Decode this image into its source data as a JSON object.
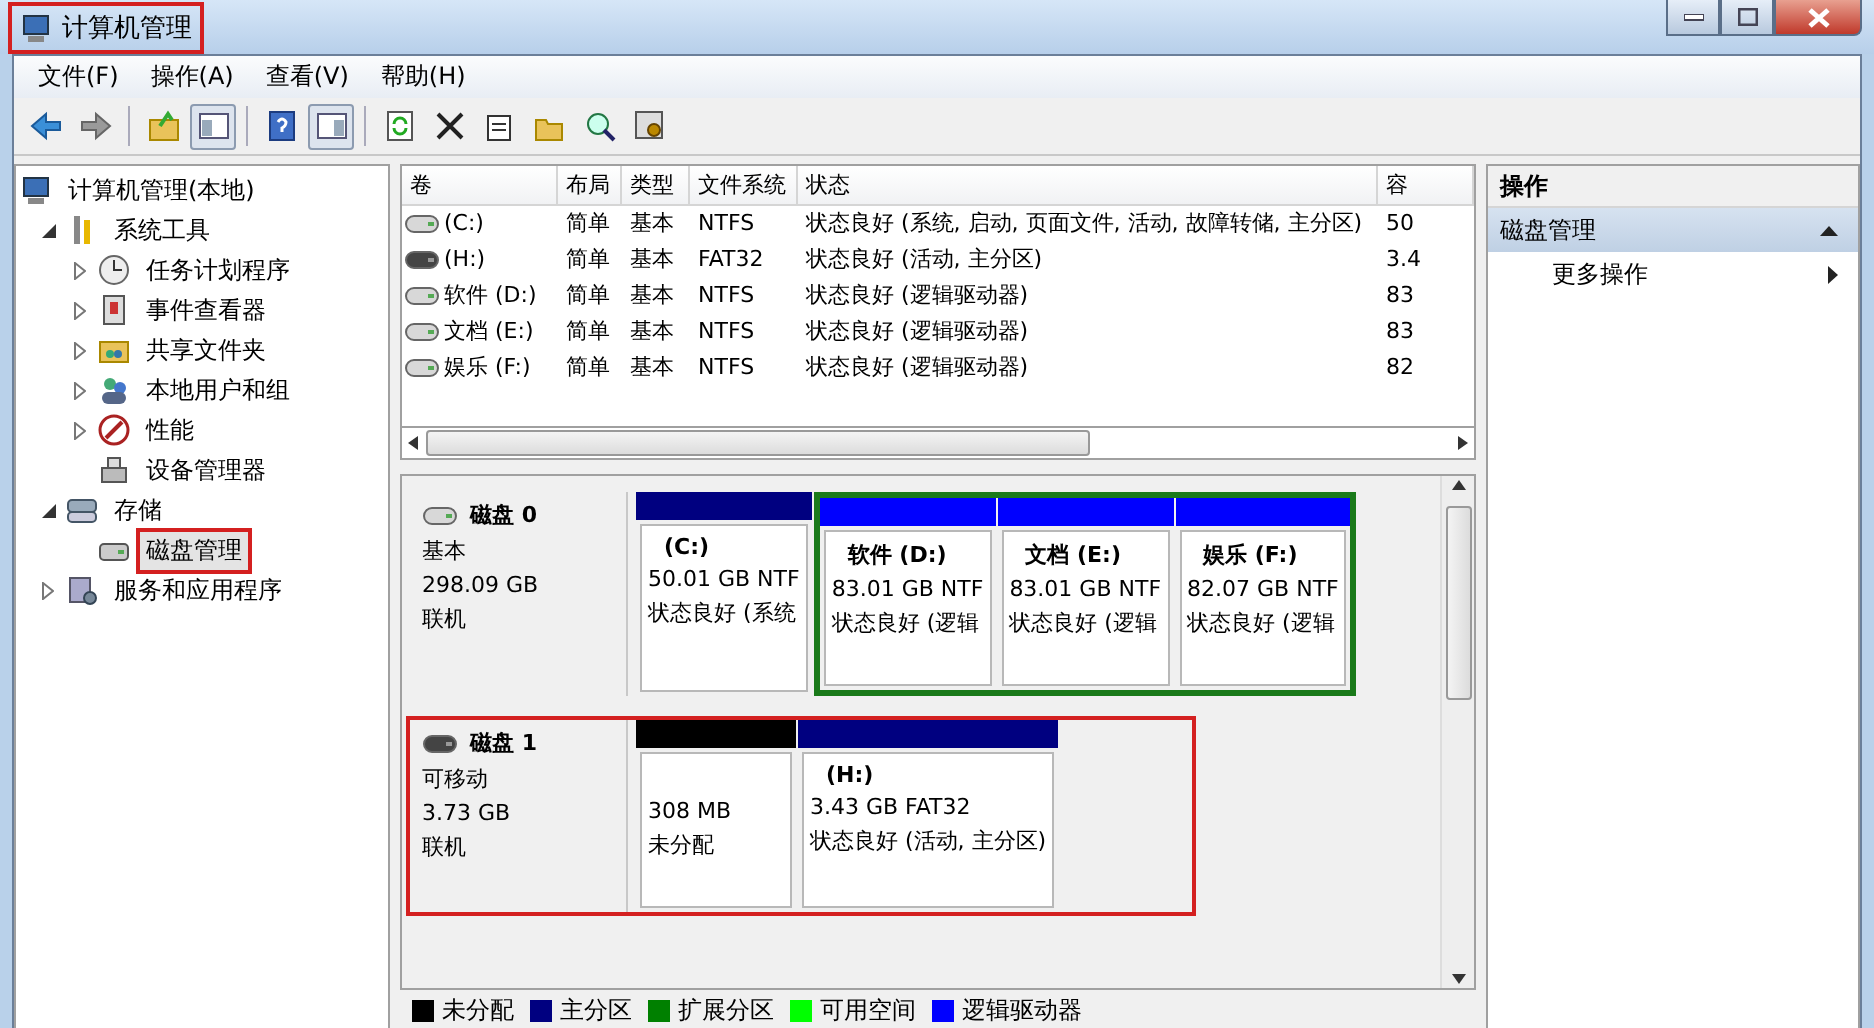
{
  "window": {
    "title": "计算机管理",
    "highlighted": true
  },
  "menu": [
    "文件(F)",
    "操作(A)",
    "查看(V)",
    "帮助(H)"
  ],
  "toolbar": [
    [
      {
        "kind": "back",
        "pressed": false
      },
      {
        "kind": "forward",
        "pressed": false
      }
    ],
    [
      {
        "kind": "up",
        "pressed": false
      },
      {
        "kind": "tree-toggle",
        "pressed": true
      }
    ],
    [
      {
        "kind": "help",
        "pressed": false
      },
      {
        "kind": "action-toggle",
        "pressed": true
      }
    ],
    [
      {
        "kind": "refresh",
        "pressed": false
      },
      {
        "kind": "delete",
        "pressed": false
      },
      {
        "kind": "properties",
        "pressed": false
      },
      {
        "kind": "open",
        "pressed": false
      },
      {
        "kind": "find",
        "pressed": false
      },
      {
        "kind": "settings",
        "pressed": false
      }
    ]
  ],
  "tree": [
    {
      "label": "计算机管理(本地)",
      "kind": "computer",
      "expandable": false,
      "selected": false,
      "highlighted": false,
      "children": [
        {
          "label": "系统工具",
          "kind": "tools",
          "expandable": true,
          "expanded": true,
          "selected": false,
          "highlighted": false,
          "children": [
            {
              "label": "任务计划程序",
              "kind": "clock",
              "expandable": true,
              "expanded": false,
              "selected": false,
              "highlighted": false
            },
            {
              "label": "事件查看器",
              "kind": "event",
              "expandable": true,
              "expanded": false,
              "selected": false,
              "highlighted": false
            },
            {
              "label": "共享文件夹",
              "kind": "share",
              "expandable": true,
              "expanded": false,
              "selected": false,
              "highlighted": false
            },
            {
              "label": "本地用户和组",
              "kind": "users",
              "expandable": true,
              "expanded": false,
              "selected": false,
              "highlighted": false
            },
            {
              "label": "性能",
              "kind": "perf",
              "expandable": true,
              "expanded": false,
              "selected": false,
              "highlighted": false
            },
            {
              "label": "设备管理器",
              "kind": "device",
              "expandable": false,
              "selected": false,
              "highlighted": false
            }
          ]
        },
        {
          "label": "存储",
          "kind": "storage",
          "expandable": true,
          "expanded": true,
          "selected": false,
          "highlighted": false,
          "children": [
            {
              "label": "磁盘管理",
              "kind": "disk",
              "expandable": false,
              "selected": true,
              "highlighted": true
            }
          ]
        },
        {
          "label": "服务和应用程序",
          "kind": "services",
          "expandable": true,
          "expanded": false,
          "selected": false,
          "highlighted": false
        }
      ]
    }
  ],
  "table": {
    "columns": [
      "卷",
      "布局",
      "类型",
      "文件系统",
      "状态",
      "容"
    ],
    "rows": [
      {
        "kind": "fixed",
        "cells": [
          "(C:)",
          "简单",
          "基本",
          "NTFS",
          "状态良好 (系统, 启动, 页面文件, 活动, 故障转储, 主分区)",
          "50"
        ]
      },
      {
        "kind": "removable",
        "cells": [
          "(H:)",
          "简单",
          "基本",
          "FAT32",
          "状态良好 (活动, 主分区)",
          "3.4"
        ]
      },
      {
        "kind": "fixed",
        "cells": [
          "软件 (D:)",
          "简单",
          "基本",
          "NTFS",
          "状态良好 (逻辑驱动器)",
          "83"
        ]
      },
      {
        "kind": "fixed",
        "cells": [
          "文档 (E:)",
          "简单",
          "基本",
          "NTFS",
          "状态良好 (逻辑驱动器)",
          "83"
        ]
      },
      {
        "kind": "fixed",
        "cells": [
          "娱乐 (F:)",
          "简单",
          "基本",
          "NTFS",
          "状态良好 (逻辑驱动器)",
          "82"
        ]
      }
    ]
  },
  "disks": [
    {
      "name": "磁盘 0",
      "kind": "fixed",
      "type": "基本",
      "size": "298.09 GB",
      "status": "联机",
      "highlighted": false,
      "partitions": [
        {
          "kind": "primary",
          "title": "(C:)",
          "size": "50.01 GB NTF",
          "status": "状态良好 (系统"
        },
        {
          "kind": "extended",
          "partitions": [
            {
              "kind": "logical",
              "title": "软件  (D:)",
              "size": "83.01 GB NTF",
              "status": "状态良好 (逻辑"
            },
            {
              "kind": "logical",
              "title": "文档  (E:)",
              "size": "83.01 GB NTF",
              "status": "状态良好 (逻辑"
            },
            {
              "kind": "logical",
              "title": "娱乐  (F:)",
              "size": "82.07 GB NTF",
              "status": "状态良好 (逻辑"
            }
          ]
        }
      ]
    },
    {
      "name": "磁盘 1",
      "kind": "removable",
      "type": "可移动",
      "size": "3.73 GB",
      "status": "联机",
      "highlighted": true,
      "partitions": [
        {
          "kind": "unallocated",
          "size": "308 MB",
          "status": "未分配"
        },
        {
          "kind": "primary",
          "title": "(H:)",
          "size": "3.43 GB FAT32",
          "status": "状态良好 (活动, 主分区)"
        }
      ]
    }
  ],
  "legend": [
    {
      "label": "未分配",
      "color": "#000000"
    },
    {
      "label": "主分区",
      "color": "#000080"
    },
    {
      "label": "扩展分区",
      "color": "#008000"
    },
    {
      "label": "可用空间",
      "color": "#00ff00"
    },
    {
      "label": "逻辑驱动器",
      "color": "#0000ff"
    }
  ],
  "actions": {
    "header": "操作",
    "section": {
      "label": "磁盘管理",
      "expanded": true,
      "items": [
        {
          "label": "更多操作"
        }
      ]
    }
  }
}
